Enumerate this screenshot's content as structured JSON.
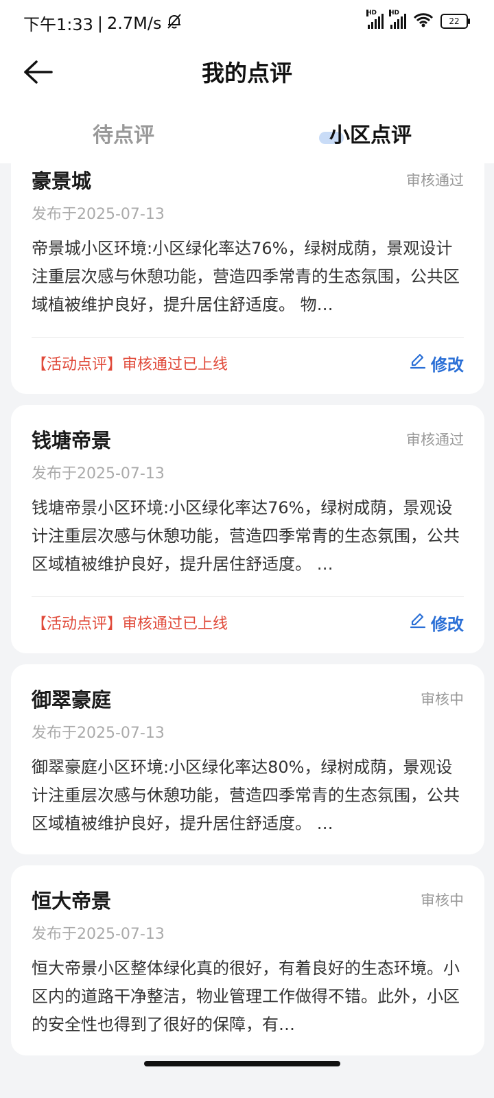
{
  "status_bar": {
    "time": "下午1:33",
    "separator": "|",
    "net_speed": "2.7M/s",
    "signal1_label": "HD",
    "signal2_label": "HD",
    "battery": "22"
  },
  "header": {
    "title": "我的点评"
  },
  "tabs": [
    {
      "label": "待点评",
      "active": false
    },
    {
      "label": "小区点评",
      "active": true
    }
  ],
  "reviews": [
    {
      "title": "豪景城",
      "status": "审核通过",
      "date": "发布于2025-07-13",
      "body": "帝景城小区环境:小区绿化率达76%，绿树成荫，景观设计注重层次感与休憩功能，营造四季常青的生态氛围，公共区域植被维护良好，提升居住舒适度。 物…",
      "activity_tag": "【活动点评】审核通过已上线",
      "edit_label": "修改"
    },
    {
      "title": "钱塘帝景",
      "status": "审核通过",
      "date": "发布于2025-07-13",
      "body": "钱塘帝景小区环境:小区绿化率达76%，绿树成荫，景观设计注重层次感与休憩功能，营造四季常青的生态氛围，公共区域植被维护良好，提升居住舒适度。 …",
      "activity_tag": "【活动点评】审核通过已上线",
      "edit_label": "修改"
    },
    {
      "title": "御翠豪庭",
      "status": "审核中",
      "date": "发布于2025-07-13",
      "body": "御翠豪庭小区环境:小区绿化率达80%，绿树成荫，景观设计注重层次感与休憩功能，营造四季常青的生态氛围，公共区域植被维护良好，提升居住舒适度。 …"
    },
    {
      "title": "恒大帝景",
      "status": "审核中",
      "date": "发布于2025-07-13",
      "body": "恒大帝景小区整体绿化真的很好，有着良好的生态环境。小区内的道路干净整洁，物业管理工作做得不错。此外，小区的安全性也得到了很好的保障，有…"
    }
  ],
  "colors": {
    "accent": "#2a6fd6",
    "activity_red": "#e04a3a",
    "tab_highlight": "#c9dcf7",
    "background": "#f3f4f6"
  }
}
